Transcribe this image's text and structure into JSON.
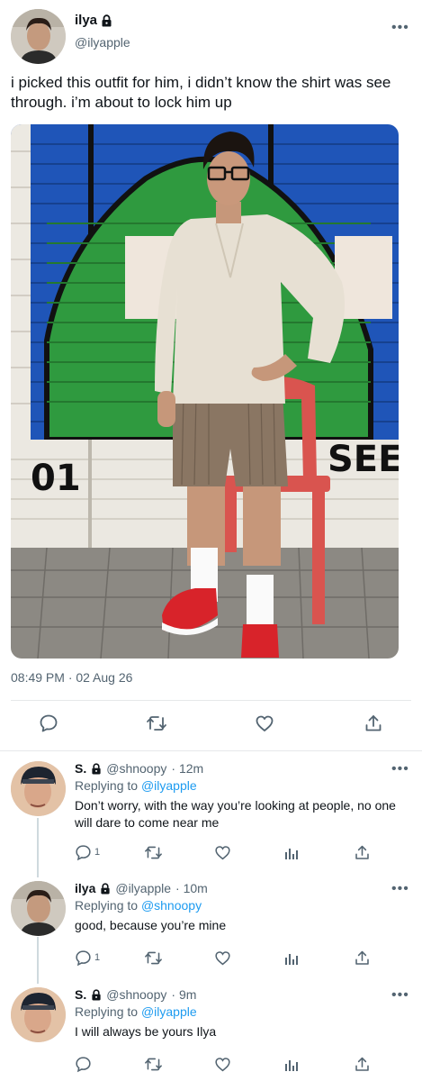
{
  "tweet": {
    "display_name": "ilya",
    "handle": "@ilyapple",
    "text": "i picked this outfit for him, i didn’t know the shirt was see through. i’m about to lock him up",
    "timestamp": "08:49 PM · 02 Aug 26",
    "photo": {
      "wall_number": "01",
      "wall_text": "SEE"
    }
  },
  "replies": [
    {
      "display_name": "S.",
      "handle": "@shnoopy",
      "time": "· 12m",
      "replying_prefix": "Replying to",
      "replying_to": "@ilyapple",
      "text": "Don’t worry, with the way you’re looking at people, no one will dare to come near me",
      "reply_count": "1"
    },
    {
      "display_name": "ilya",
      "handle": "@ilyapple",
      "time": "· 10m",
      "replying_prefix": "Replying to",
      "replying_to": "@shnoopy",
      "text": "good, because you’re mine",
      "reply_count": "1"
    },
    {
      "display_name": "S.",
      "handle": "@shnoopy",
      "time": "· 9m",
      "replying_prefix": "Replying to",
      "replying_to": "@ilyapple",
      "text": "I will always be yours Ilya",
      "reply_count": ""
    }
  ],
  "icons": {
    "verified_lock": "lock-icon",
    "reply": "reply-icon",
    "retweet": "retweet-icon",
    "like": "heart-icon",
    "analytics": "analytics-icon",
    "share": "share-icon",
    "more": "more-icon"
  },
  "colors": {
    "text": "#0f1419",
    "secondary": "#536471",
    "accent": "#1d9bf0",
    "divider": "#e6e8ea"
  }
}
